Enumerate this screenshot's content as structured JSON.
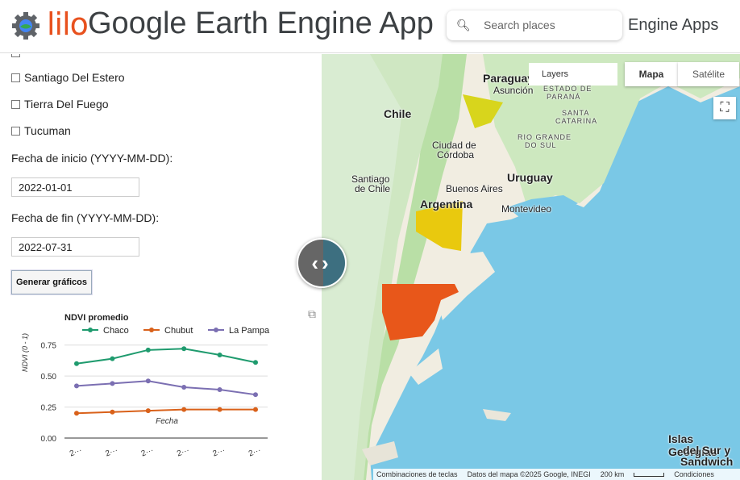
{
  "header": {
    "brand": "lilo",
    "title": "Google Earth Engine App",
    "search_placeholder": "Search places",
    "engine_apps": "Engine Apps"
  },
  "panel": {
    "provinces": [
      "Santiago Del Estero",
      "Tierra Del Fuego",
      "Tucuman"
    ],
    "start_label": "Fecha de inicio (YYYY-MM-DD):",
    "start_value": "2022-01-01",
    "end_label": "Fecha de fin (YYYY-MM-DD):",
    "end_value": "2022-07-31",
    "generate_label": "Generar gráficos"
  },
  "chart_data": {
    "type": "line",
    "title": "NDVI promedio",
    "xlabel": "Fecha",
    "ylabel": "NDVI (0 - 1)",
    "x": [
      "2···",
      "2···",
      "2···",
      "2···",
      "2···",
      "2···"
    ],
    "yticks": [
      "0.00",
      "0.25",
      "0.50",
      "0.75"
    ],
    "ylim": [
      0,
      0.8
    ],
    "legend_position": "top",
    "series": [
      {
        "name": "Chaco",
        "color": "#1f9b6e",
        "values": [
          0.6,
          0.64,
          0.71,
          0.72,
          0.67,
          0.61
        ]
      },
      {
        "name": "Chubut",
        "color": "#d9611a",
        "values": [
          0.2,
          0.21,
          0.22,
          0.23,
          0.23,
          0.23
        ]
      },
      {
        "name": "La Pampa",
        "color": "#7b6fb2",
        "values": [
          0.42,
          0.44,
          0.46,
          0.41,
          0.39,
          0.35
        ]
      }
    ]
  },
  "map": {
    "layers": "Layers",
    "mapa": "Mapa",
    "satelite": "Satélite",
    "fullscreen_icon": "fullscreen-icon",
    "places": {
      "paraguay": "Paraguay",
      "asuncion": "Asunción",
      "chile": "Chile",
      "estado": "ESTADO DE",
      "parana": "PARANÁ",
      "santa": "SANTA",
      "catarina": "CATARINA",
      "rio_grande": "RIO GRANDE",
      "do_sul": "DO SUL",
      "ciudad_de": "Ciudad de",
      "cordoba": "Córdoba",
      "uruguay": "Uruguay",
      "santiago": "Santiago",
      "de_chile": "de Chile",
      "buenos_aires": "Buenos Aires",
      "montevideo": "Montevideo",
      "argentina": "Argentina",
      "islas": "Islas Georgias",
      "del_sur_y": "del Sur y",
      "sandwich": "Sandwich"
    },
    "attribution": {
      "shortcuts": "Combinaciones de teclas",
      "data": "Datos del mapa ©2025 Google, INEGI",
      "scale": "200 km",
      "terms": "Condiciones"
    }
  }
}
